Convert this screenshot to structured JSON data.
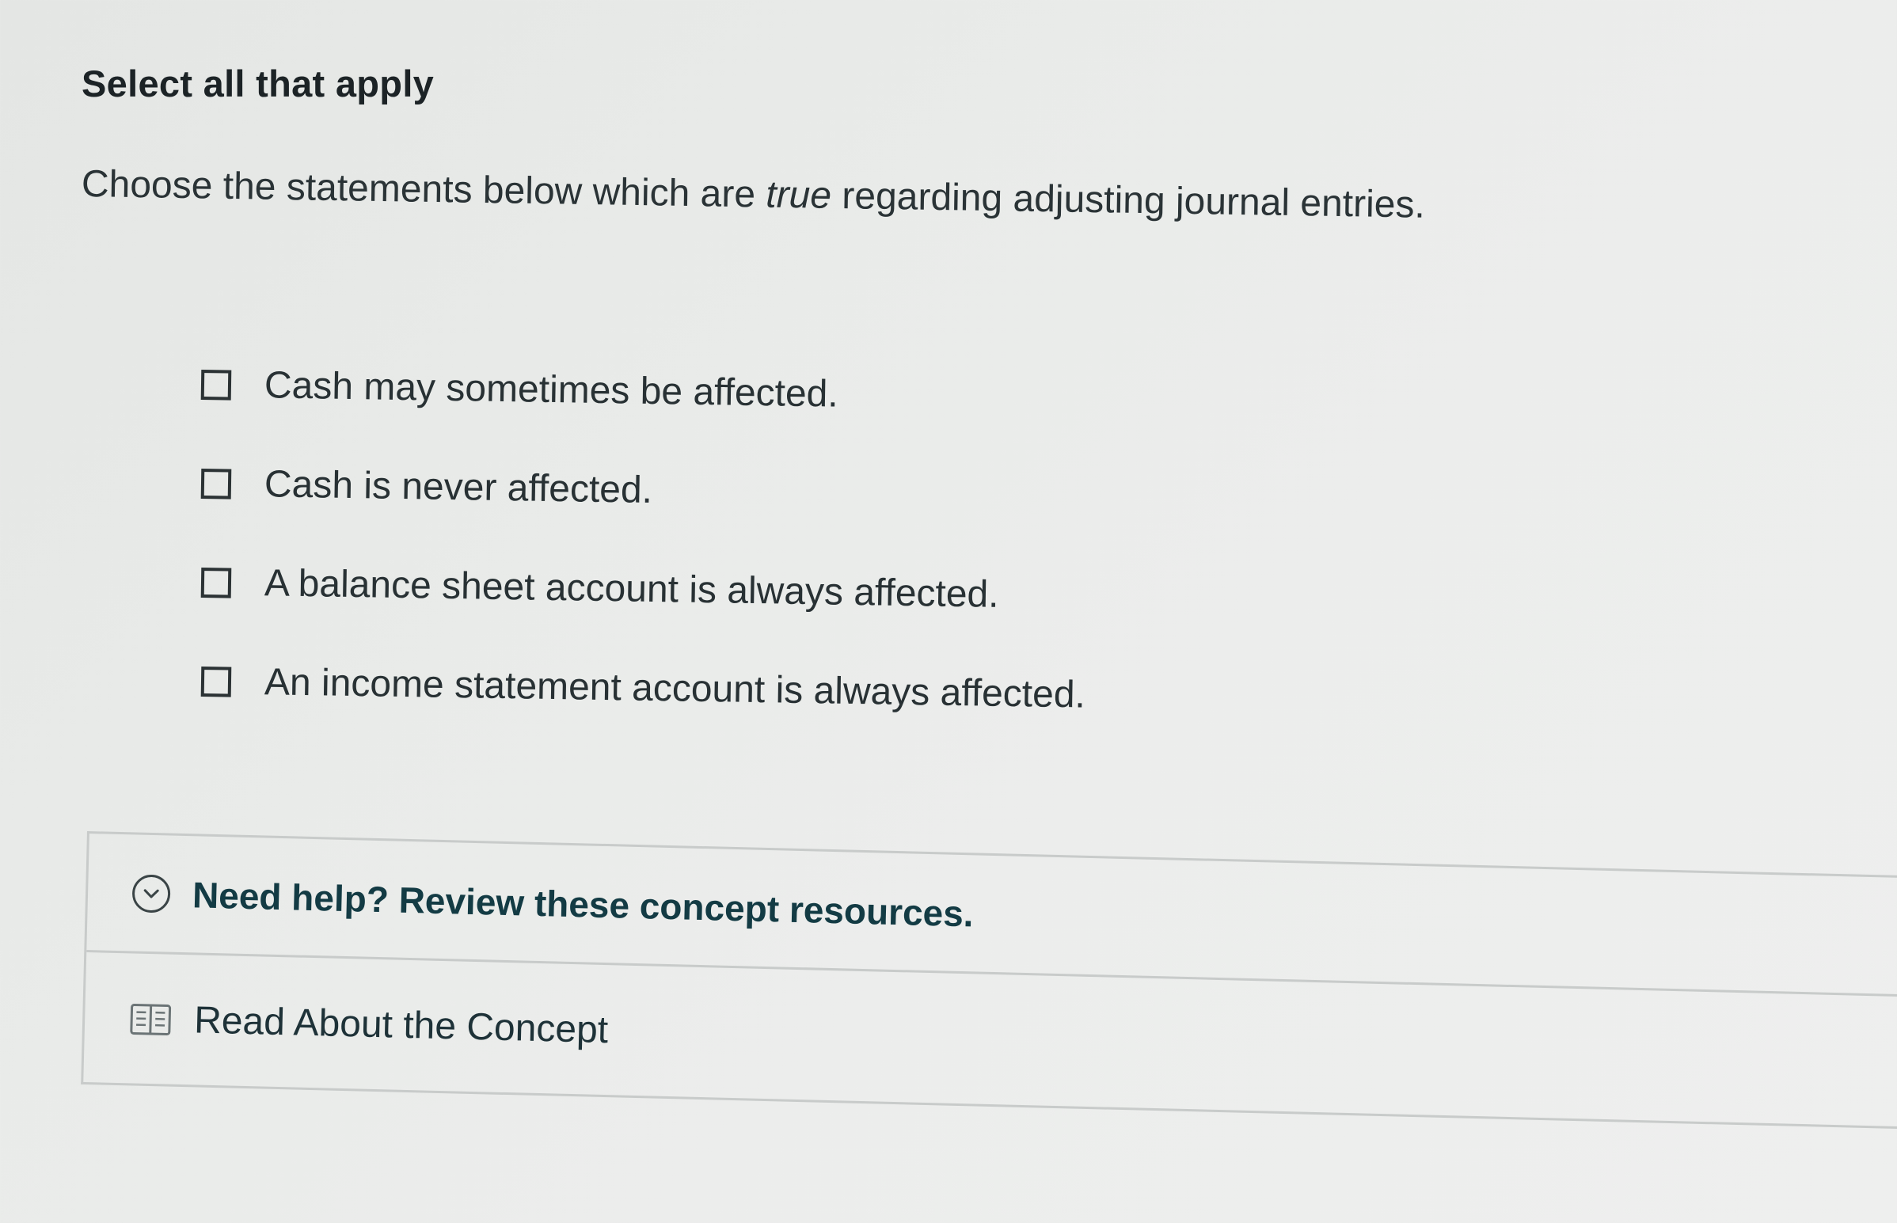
{
  "question": {
    "prompt_type": "Select all that apply",
    "text_before": "Choose the statements below which are ",
    "text_emphasis": "true",
    "text_after": " regarding adjusting journal entries."
  },
  "options": [
    {
      "label": "Cash may sometimes be affected.",
      "checked": false
    },
    {
      "label": "Cash is never affected.",
      "checked": false
    },
    {
      "label": "A balance sheet account is always affected.",
      "checked": false
    },
    {
      "label": "An income statement account is always affected.",
      "checked": false
    }
  ],
  "resources": {
    "header_label": "Need help? Review these concept resources.",
    "header_icon": "chevron-down-circle-icon",
    "link_label": "Read About the Concept",
    "link_icon": "book-icon"
  },
  "colors": {
    "background": "#e9ebe9",
    "text": "#283134",
    "resources_title": "#133b44",
    "divider": "#c8cbca"
  }
}
